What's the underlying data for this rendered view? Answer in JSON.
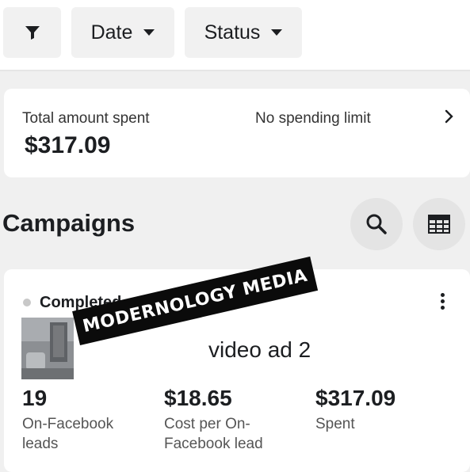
{
  "filters": {
    "filter_icon": "filter-funnel-icon",
    "date_label": "Date",
    "status_label": "Status"
  },
  "spend": {
    "label": "Total amount spent",
    "value": "$317.09",
    "limit_text": "No spending limit"
  },
  "campaigns": {
    "title": "Campaigns",
    "search_icon": "search-icon",
    "columns_icon": "table-columns-icon",
    "card": {
      "status": "Completed",
      "ad_name": "video ad 2",
      "metrics": [
        {
          "value": "19",
          "label": "On-Facebook leads"
        },
        {
          "value": "$18.65",
          "label": "Cost per On-Facebook lead"
        },
        {
          "value": "$317.09",
          "label": "Spent"
        }
      ]
    }
  },
  "watermark": {
    "text": "MODERNOLOGY MEDIA"
  },
  "colors": {
    "background": "#f0f0f0",
    "card": "#ffffff",
    "chip": "#f1f1f1",
    "round_button": "#e4e4e4",
    "status_dot": "#c8c8c8",
    "watermark_bg": "#0b0b0b"
  }
}
